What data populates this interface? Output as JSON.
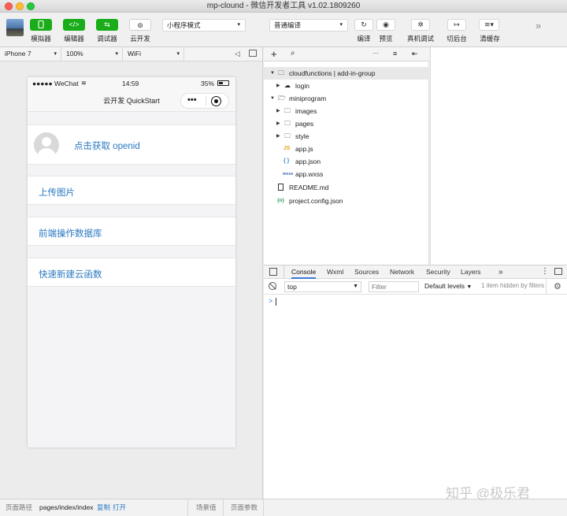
{
  "window": {
    "title": "mp-clound - 微信开发者工具 v1.02.1809260"
  },
  "toolbar": {
    "simulator_label": "模拟器",
    "editor_label": "编辑器",
    "debugger_label": "调试器",
    "cloud_label": "云开发",
    "mode_select": "小程序模式",
    "compile_select": "普通编译",
    "compile_label": "编译",
    "preview_label": "预览",
    "device_debug_label": "真机调试",
    "background_label": "切后台",
    "clear_cache_label": "清缓存",
    "more": "»"
  },
  "simulator": {
    "device": "iPhone 7",
    "zoom": "100%",
    "network": "WiFi",
    "status": {
      "carrier": "●●●●● WeChat",
      "time": "14:59",
      "battery": "35%"
    },
    "nav_title": "云开发 QuickStart",
    "capsule_dots": "•••",
    "items": {
      "openid": "点击获取 openid",
      "upload": "上传图片",
      "database": "前端操作数据库",
      "cloudfn": "快速新建云函数"
    }
  },
  "tree": {
    "toolbar": {
      "add": "+",
      "search": "⌕",
      "more": "···"
    },
    "items": [
      {
        "label": "cloudfunctions | add-in-group"
      },
      {
        "label": "login"
      },
      {
        "label": "miniprogram"
      },
      {
        "label": "images"
      },
      {
        "label": "pages"
      },
      {
        "label": "style"
      },
      {
        "label": "app.js"
      },
      {
        "label": "app.json"
      },
      {
        "label": "app.wxss"
      },
      {
        "label": "README.md"
      },
      {
        "label": "project.config.json"
      }
    ],
    "icons": {
      "js": "JS",
      "json": "{ }",
      "wxss": "wxss",
      "config": "{o}"
    }
  },
  "devtools": {
    "tabs": [
      "Console",
      "Wxml",
      "Sources",
      "Network",
      "Security",
      "Layers"
    ],
    "more": "»",
    "context": "top",
    "filter_placeholder": "Filter",
    "levels": "Default levels",
    "hidden": "1 item hidden by filters",
    "prompt": ">"
  },
  "footer": {
    "path_label": "页面路径",
    "path": "pages/index/index",
    "copy": "复制",
    "open": "打开",
    "scene_label": "场景值",
    "params_label": "页面参数"
  },
  "watermark": "知乎 @极乐君",
  "colors": {
    "accent_green": "#1aad19",
    "link_blue": "#2a78c0",
    "tab_blue": "#3879d9"
  }
}
